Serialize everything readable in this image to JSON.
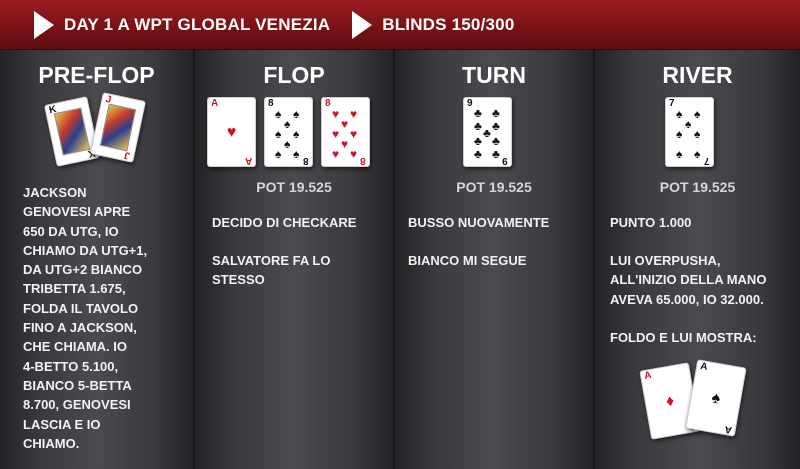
{
  "header": {
    "segments": [
      {
        "text": "DAY 1 A WPT GLOBAL VENEZIA",
        "icon": "play-arrow-icon"
      },
      {
        "text": "BLINDS 150/300",
        "icon": "play-arrow-icon"
      }
    ]
  },
  "colors": {
    "header_red": "#8a161b",
    "card_red": "#d5141b",
    "panel": "#3a3a3e"
  },
  "columns": [
    {
      "title": "PRE-FLOP",
      "cards": [
        {
          "rank": "K",
          "suit": "spades"
        },
        {
          "rank": "J",
          "suit": "hearts"
        }
      ],
      "text": "JACKSON\nGENOVESI APRE\n650 DA UTG, IO\nCHIAMO DA UTG+1,\nDA UTG+2 BIANCO\nTRIBETTA 1.675,\nFOLDA IL TAVOLO\nFINO A JACKSON,\nCHE CHIAMA. IO\n4-BETTO 5.100,\nBIANCO 5-BETTA\n8.700, GENOVESI\nLASCIA E IO\nCHIAMO."
    },
    {
      "title": "FLOP",
      "cards": [
        {
          "rank": "A",
          "suit": "hearts"
        },
        {
          "rank": "8",
          "suit": "spades"
        },
        {
          "rank": "8",
          "suit": "hearts"
        }
      ],
      "pot": "POT 19.525",
      "actions": [
        "DECIDO DI CHECKARE",
        "SALVATORE FA LO\nSTESSO"
      ]
    },
    {
      "title": "TURN",
      "cards": [
        {
          "rank": "9",
          "suit": "clubs"
        }
      ],
      "pot": "POT 19.525",
      "actions": [
        "BUSSO NUOVAMENTE",
        "BIANCO MI SEGUE"
      ]
    },
    {
      "title": "RIVER",
      "cards": [
        {
          "rank": "7",
          "suit": "spades"
        }
      ],
      "pot": "POT 19.525",
      "actions": [
        "PUNTO 1.000",
        "LUI OVERPUSHA,\nALL'INIZIO DELLA MANO\nAVEVA 65.000, IO 32.000.",
        "FOLDO E LUI MOSTRA:"
      ],
      "shown_cards": [
        {
          "rank": "A",
          "suit": "diamonds"
        },
        {
          "rank": "A",
          "suit": "spades"
        }
      ]
    }
  ]
}
